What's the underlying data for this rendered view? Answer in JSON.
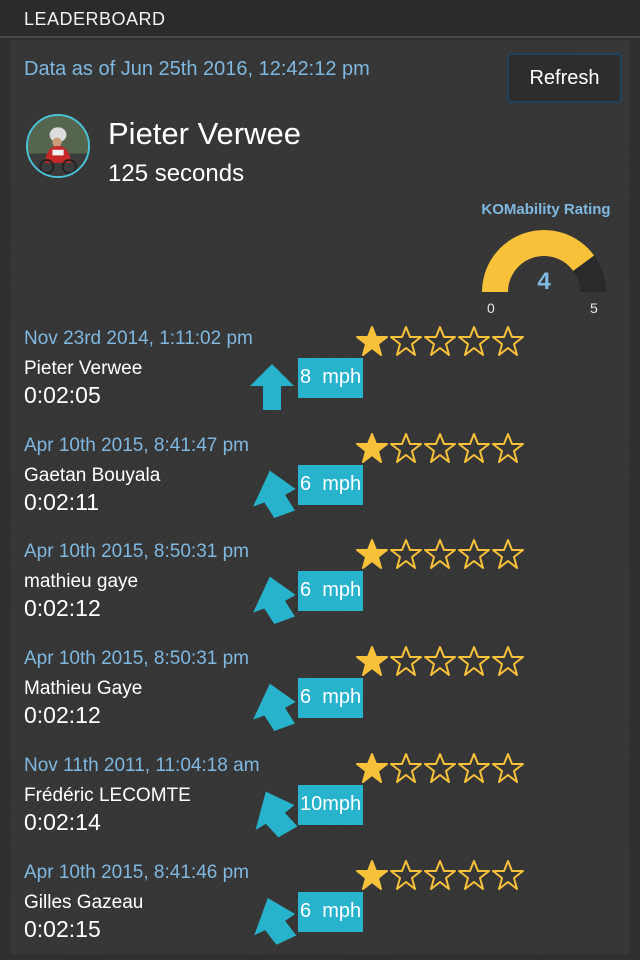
{
  "header": {
    "title": "LEADERBOARD"
  },
  "summary": {
    "data_as_of": "Data as of Jun 25th 2016, 12:42:12 pm",
    "refresh_label": "Refresh",
    "athlete_name": "Pieter Verwee",
    "athlete_time": "125 seconds"
  },
  "rating": {
    "title": "KOMability Rating",
    "value": "4",
    "value_num": 4,
    "min": "0",
    "max": "5",
    "fill_color": "#f7c13a",
    "track_color": "#2a2a2a",
    "value_color": "#7fb8e0"
  },
  "colors": {
    "accent": "#27b3cc",
    "date_text": "#7fb8e0",
    "star_color": "#f7c13a"
  },
  "icons": {
    "star": "star-icon",
    "wind": "wind-arrow-icon",
    "refresh": "refresh-button"
  },
  "entries": [
    {
      "date": "Nov 23rd 2014, 1:11:02 pm",
      "name": "Pieter Verwee",
      "time": "0:02:05",
      "stars": 1,
      "wind": "8  mph"
    },
    {
      "date": "Apr 10th 2015, 8:41:47 pm",
      "name": "Gaetan Bouyala",
      "time": "0:02:11",
      "stars": 1,
      "wind": "6  mph"
    },
    {
      "date": "Apr 10th 2015, 8:50:31 pm",
      "name": "mathieu gaye",
      "time": "0:02:12",
      "stars": 1,
      "wind": "6  mph"
    },
    {
      "date": "Apr 10th 2015, 8:50:31 pm",
      "name": "Mathieu Gaye",
      "time": "0:02:12",
      "stars": 1,
      "wind": "6  mph"
    },
    {
      "date": "Nov 11th 2011, 11:04:18 am",
      "name": "Frédéric LECOMTE",
      "time": "0:02:14",
      "stars": 1,
      "wind": "10mph"
    },
    {
      "date": "Apr 10th 2015, 8:41:46 pm",
      "name": "Gilles Gazeau",
      "time": "0:02:15",
      "stars": 1,
      "wind": "6  mph"
    }
  ]
}
